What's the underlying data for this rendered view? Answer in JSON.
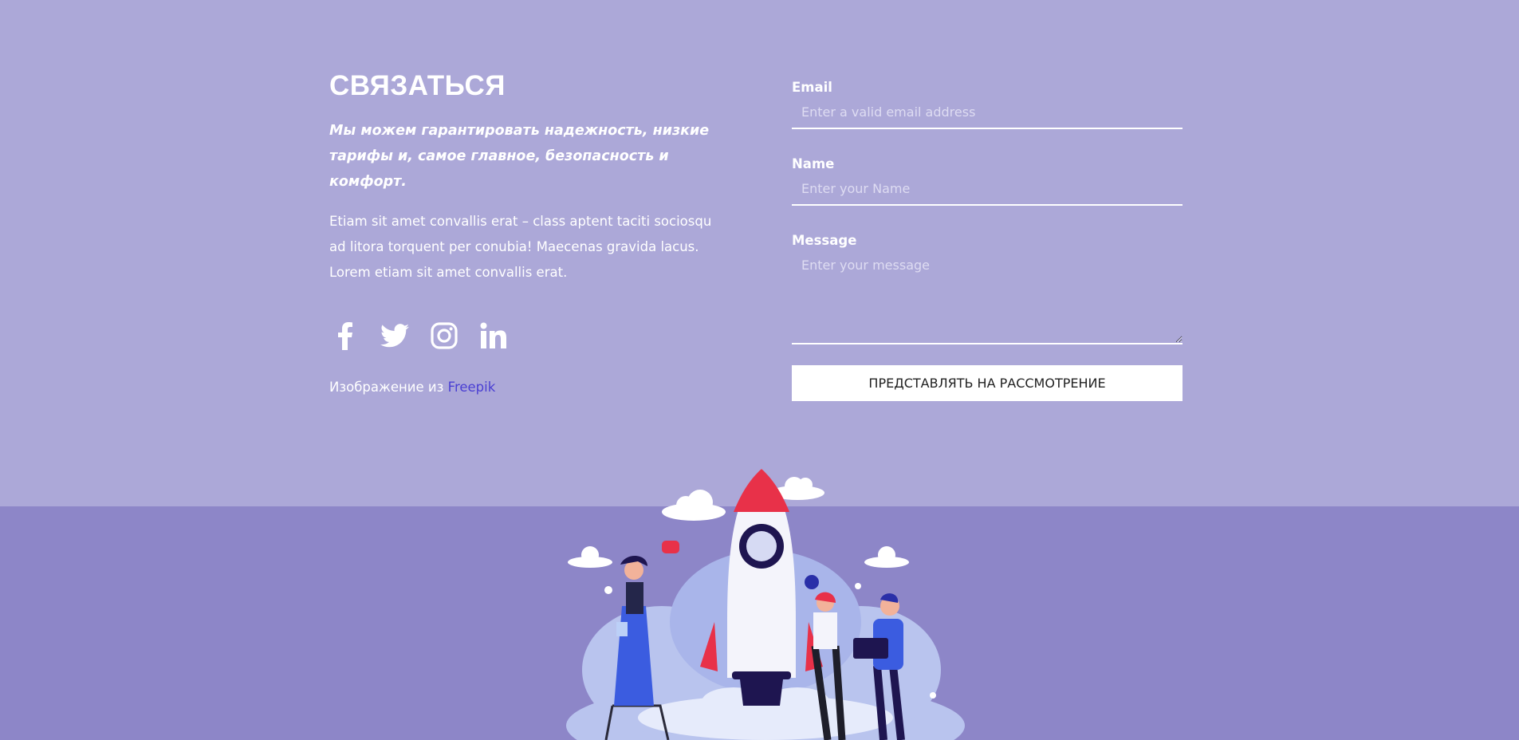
{
  "contact": {
    "title": "СВЯЗАТЬСЯ",
    "tagline": "Мы можем гарантировать надежность, низкие тарифы и, самое главное, безопасность и комфорт.",
    "body": "Etiam sit amet convallis erat – class aptent taciti sociosqu ad litora torquent per conubia! Maecenas gravida lacus. Lorem etiam sit amet convallis erat.",
    "social_icons": [
      "facebook-icon",
      "twitter-icon",
      "instagram-icon",
      "linkedin-icon"
    ],
    "credit_prefix": "Изображение из",
    "credit_link": "Freepik"
  },
  "form": {
    "email_label": "Email",
    "email_placeholder": "Enter a valid email address",
    "name_label": "Name",
    "name_placeholder": "Enter your Name",
    "message_label": "Message",
    "message_placeholder": "Enter your message",
    "submit_label": "ПРЕДСТАВЛЯТЬ НА РАССМОТРЕНИЕ"
  },
  "colors": {
    "background_top": "#aca8d8",
    "background_bottom": "#8d86c8",
    "link": "#4a3fd3",
    "button_bg": "#ffffff"
  }
}
